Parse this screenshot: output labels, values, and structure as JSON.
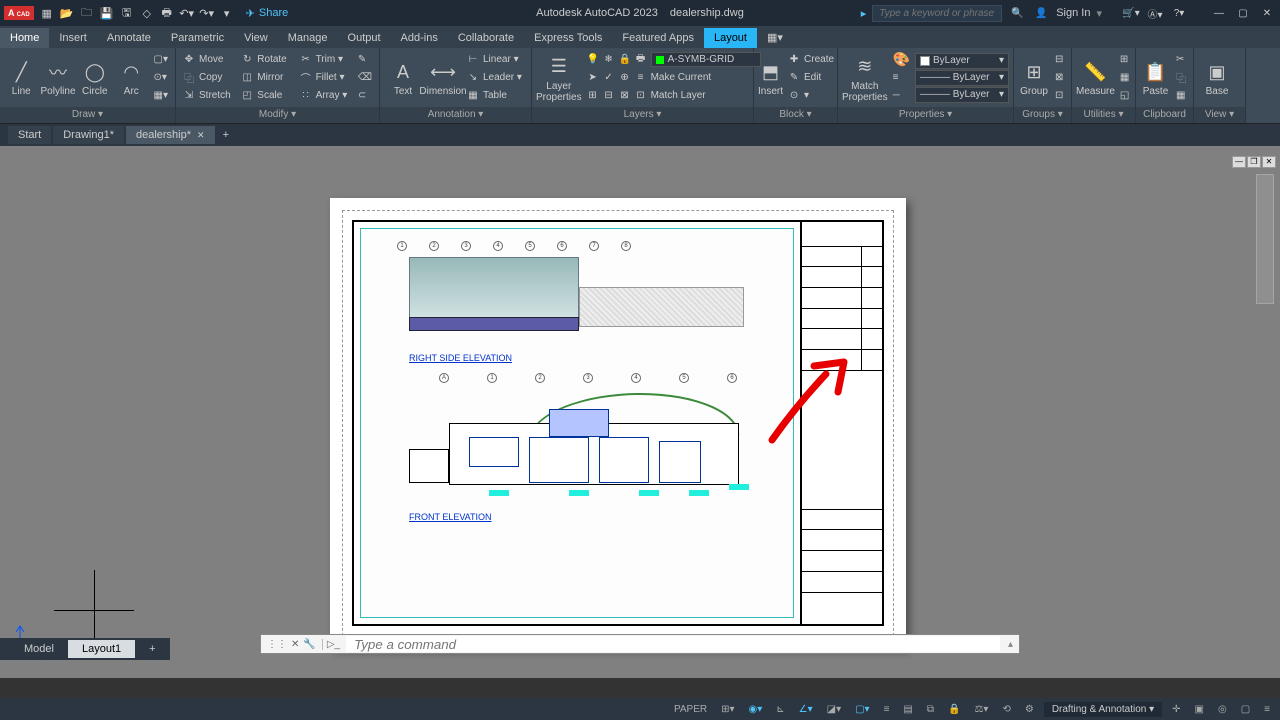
{
  "app": {
    "title": "Autodesk AutoCAD 2023",
    "file": "dealership.dwg"
  },
  "qat": {
    "share": "Share"
  },
  "titleRight": {
    "searchPlaceholder": "Type a keyword or phrase",
    "signIn": "Sign In"
  },
  "menuTabs": [
    "Home",
    "Insert",
    "Annotate",
    "Parametric",
    "View",
    "Manage",
    "Output",
    "Add-ins",
    "Collaborate",
    "Express Tools",
    "Featured Apps",
    "Layout"
  ],
  "ribbon": {
    "draw": {
      "title": "Draw ▾",
      "line": "Line",
      "polyline": "Polyline",
      "circle": "Circle",
      "arc": "Arc"
    },
    "modify": {
      "title": "Modify ▾",
      "move": "Move",
      "rotate": "Rotate",
      "trim": "Trim ▾",
      "copy": "Copy",
      "mirror": "Mirror",
      "fillet": "Fillet ▾",
      "stretch": "Stretch",
      "scale": "Scale",
      "array": "Array ▾"
    },
    "annotation": {
      "title": "Annotation ▾",
      "text": "Text",
      "dimension": "Dimension",
      "linear": "Linear ▾",
      "leader": "Leader ▾",
      "table": "Table"
    },
    "layers": {
      "title": "Layers ▾",
      "layerProps": "Layer\nProperties",
      "current": "A-SYMB-GRID",
      "makeCurrent": "Make Current",
      "matchLayer": "Match Layer"
    },
    "block": {
      "title": "Block ▾",
      "insert": "Insert",
      "create": "Create",
      "edit": "Edit"
    },
    "properties": {
      "title": "Properties ▾",
      "match": "Match\nProperties",
      "byLayer": "ByLayer"
    },
    "groups": {
      "title": "Groups ▾",
      "group": "Group"
    },
    "utilities": {
      "title": "Utilities ▾",
      "measure": "Measure"
    },
    "clipboard": {
      "title": "Clipboard",
      "paste": "Paste"
    },
    "view": {
      "title": "View ▾",
      "base": "Base"
    }
  },
  "fileTabs": {
    "start": "Start",
    "drawing1": "Drawing1*",
    "dealership": "dealership*"
  },
  "drawing": {
    "gridRow1": [
      "1",
      "2",
      "3",
      "4",
      "5",
      "6",
      "7",
      "8"
    ],
    "label1": "RIGHT SIDE ELEVATION",
    "gridRow2": [
      "A",
      "1",
      "2",
      "3",
      "4",
      "5",
      "6"
    ],
    "label2": "FRONT ELEVATION"
  },
  "cmdline": {
    "placeholder": "Type a command"
  },
  "layoutTabs": {
    "model": "Model",
    "layout1": "Layout1"
  },
  "status": {
    "space": "PAPER",
    "workspace": "Drafting & Annotation ▾"
  }
}
